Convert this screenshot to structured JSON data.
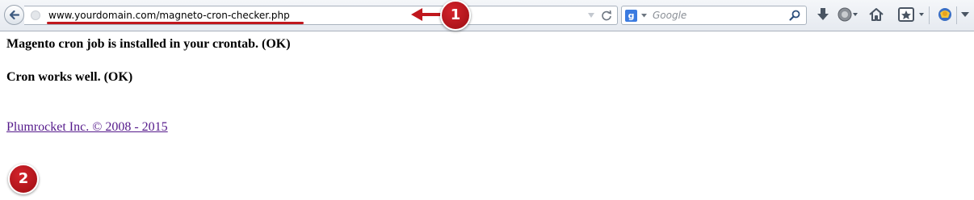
{
  "browser": {
    "url": "www.yourdomain.com/magneto-cron-checker.php",
    "search_engine_icon": "g",
    "search_placeholder": "Google"
  },
  "annotations": {
    "marker_1": "1",
    "marker_2": "2",
    "accent_color": "#c0171d"
  },
  "page": {
    "line1": "Magento cron job is installed in your crontab. (OK)",
    "line2": "Cron works well. (OK)",
    "footer_link": "Plumrocket Inc. © 2008 - 2015"
  },
  "icons": [
    "back-arrow-icon",
    "site-identity-icon",
    "dropdown-icon",
    "reload-icon",
    "google-icon",
    "search-icon",
    "download-icon",
    "account-icon",
    "home-icon",
    "bookmark-icon",
    "addon-icon",
    "menu-icon"
  ]
}
